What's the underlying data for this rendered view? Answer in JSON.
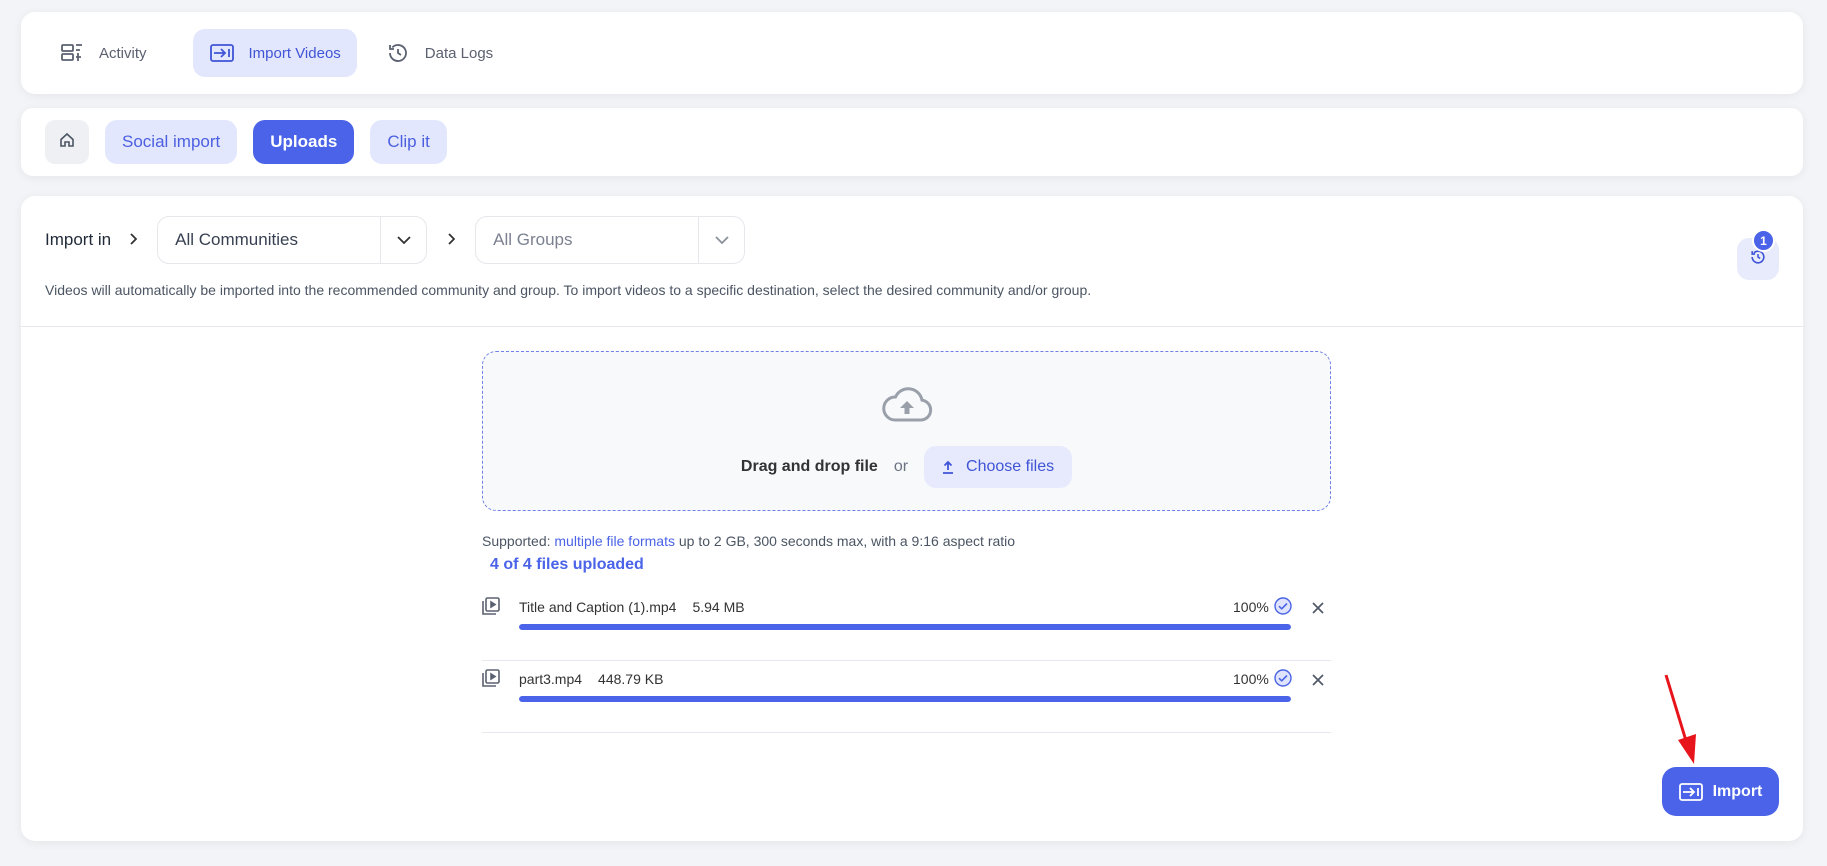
{
  "topnav": {
    "tabs": [
      {
        "label": "Activity",
        "icon": "activity-icon"
      },
      {
        "label": "Import Videos",
        "icon": "import-icon",
        "active": true
      },
      {
        "label": "Data Logs",
        "icon": "history-icon"
      }
    ]
  },
  "subnav": {
    "home_icon": "home-icon",
    "pills": [
      {
        "label": "Social import"
      },
      {
        "label": "Uploads",
        "active": true
      },
      {
        "label": "Clip it"
      }
    ]
  },
  "import": {
    "label": "Import in",
    "community": "All Communities",
    "group": "All Groups",
    "helper": "Videos will automatically be imported into the recommended community and group. To import videos to a specific destination, select the desired community and/or group.",
    "history_badge": "1"
  },
  "dropzone": {
    "drag_text": "Drag and drop file",
    "or_text": "or",
    "choose_label": "Choose files"
  },
  "supported": {
    "prefix": "Supported: ",
    "link": "multiple file formats",
    "suffix": " up to 2 GB, 300 seconds max, with a 9:16 aspect ratio"
  },
  "uploaded_count": "4 of 4 files uploaded",
  "files": [
    {
      "name": "Title and Caption (1).mp4",
      "size": "5.94 MB",
      "percent_label": "100%",
      "progress": 1.0
    },
    {
      "name": "part3.mp4",
      "size": "448.79 KB",
      "percent_label": "100%",
      "progress": 1.0
    }
  ],
  "import_button": "Import",
  "colors": {
    "accent": "#4a63e8",
    "accent_light": "#e3e7fd",
    "annotation_arrow": "#e8141c"
  }
}
